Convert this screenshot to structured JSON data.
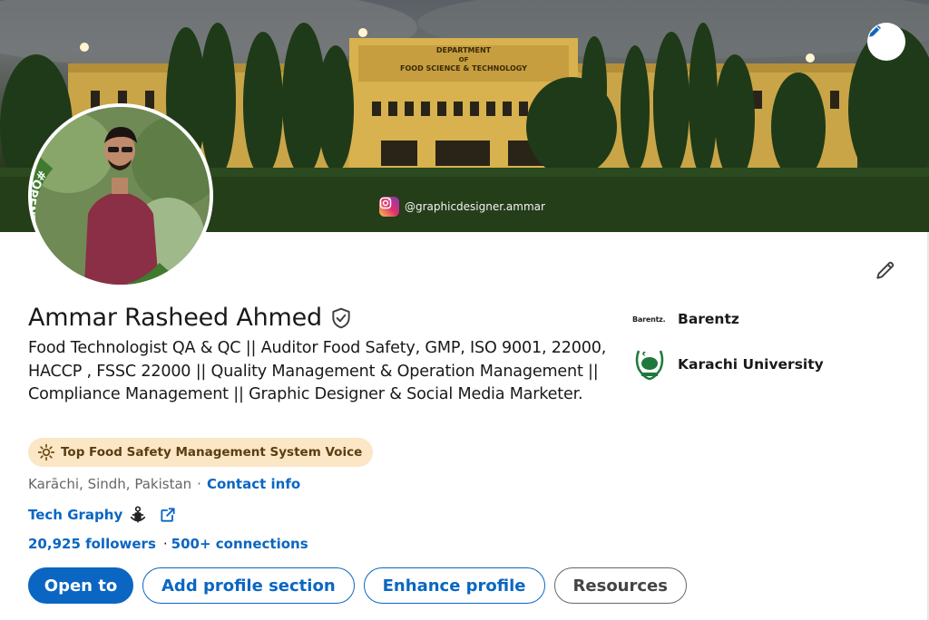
{
  "banner": {
    "sign_line1": "DEPARTMENT",
    "sign_line2": "OF",
    "sign_line3": "FOOD SCIENCE & TECHNOLOGY",
    "instagram_handle": "@graphicdesigner.ammar"
  },
  "avatar": {
    "frame_text": "#OPENTOWORK",
    "frame_color": "#3f7a2f"
  },
  "profile": {
    "name": "Ammar Rasheed Ahmed",
    "headline": "Food Technologist QA & QC || Auditor Food Safety, GMP, ISO 9001, 22000, HACCP , FSSC 22000 || Quality Management & Operation Management || Compliance Management || Graphic Designer & Social Media Marketer.",
    "voice_badge": "Top Food Safety Management System Voice",
    "location": "Karāchi, Sindh, Pakistan",
    "separator": "·",
    "contact_info": "Contact info",
    "website": "Tech Graphy",
    "followers": "20,925 followers",
    "connections_sep": "·",
    "connections": "500+ connections"
  },
  "buttons": {
    "open_to": "Open to",
    "add_section": "Add profile section",
    "enhance": "Enhance profile",
    "resources": "Resources"
  },
  "experience": {
    "company": "Barentz",
    "company_logo_text": "Barentz.",
    "education": "Karachi University"
  },
  "colors": {
    "accent": "#0a66c2",
    "badge_bg": "#fbe7c6",
    "open_to_work_green": "#3f7a2f"
  },
  "icons": {
    "banner_edit": "pencil-icon",
    "intro_edit": "pencil-icon",
    "verified": "shield-check-icon",
    "voice": "sun-icon",
    "external_link": "external-link-icon",
    "instagram": "instagram-icon"
  }
}
